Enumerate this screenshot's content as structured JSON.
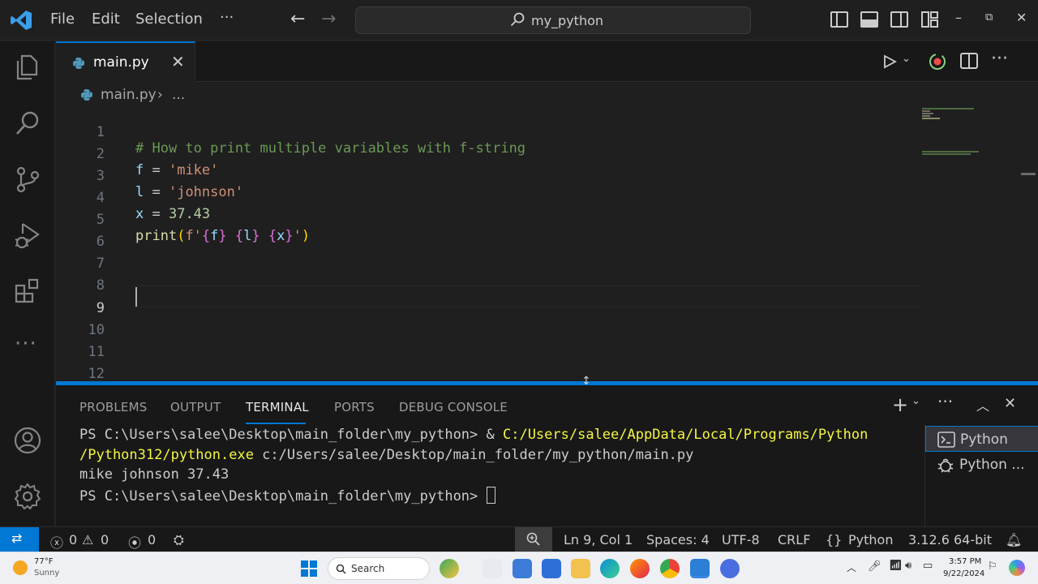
{
  "colors": {
    "accent": "#0078d4",
    "editor_bg": "#1f1f1f",
    "comment": "#6a9955",
    "string": "#ce9178",
    "variable": "#9cdcfe",
    "number": "#b5cea8",
    "function": "#dcdcaa",
    "terminal_path": "#f5f543"
  },
  "menu": {
    "file": "File",
    "edit": "Edit",
    "selection": "Selection",
    "more": "···"
  },
  "command_center": {
    "text": "my_python",
    "icon": "search-icon"
  },
  "activity_bar": {
    "top": [
      "explorer-icon",
      "search-icon",
      "source-control-icon",
      "run-debug-icon",
      "extensions-icon",
      "more-icon"
    ],
    "bottom": [
      "account-icon",
      "settings-gear-icon"
    ]
  },
  "tab": {
    "label": "main.py",
    "close": "✕"
  },
  "breadcrumb": {
    "file": "main.py",
    "separator": "›",
    "more": "..."
  },
  "editor": {
    "line_numbers": [
      "1",
      "2",
      "3",
      "4",
      "5",
      "6",
      "7",
      "8",
      "9",
      "10",
      "11",
      "12"
    ],
    "active_line": "9",
    "lines": {
      "l1": "# How to print multiple variables with f-string",
      "l2_var": "f",
      "l2_op": " = ",
      "l2_str": "'mike'",
      "l3_var": "l",
      "l3_op": " = ",
      "l3_str": "'johnson'",
      "l4_var": "x",
      "l4_op": " = ",
      "l4_num": "37.43",
      "l5_fn": "print",
      "l5_paren_open": "(",
      "l5_prefix": "f'",
      "l5_b1": "{",
      "l5_v1": "f",
      "l5_b2": "}",
      "l5_sp1": " ",
      "l5_b3": "{",
      "l5_v2": "l",
      "l5_b4": "}",
      "l5_sp2": " ",
      "l5_b5": "{",
      "l5_v3": "x",
      "l5_b6": "}",
      "l5_quote": "'",
      "l5_paren_close": ")"
    }
  },
  "panel": {
    "tabs": [
      "PROBLEMS",
      "OUTPUT",
      "TERMINAL",
      "PORTS",
      "DEBUG CONSOLE"
    ],
    "active_tab": "TERMINAL",
    "terminal": {
      "line1_prompt": "PS C:\\Users\\salee\\Desktop\\main_folder\\my_python> & ",
      "line1_path": "C:/Users/salee/AppData/Local/Programs/Python",
      "line2_path": "/Python312/python.exe",
      "line2_rest": " c:/Users/salee/Desktop/main_folder/my_python/main.py",
      "line3": "mike johnson 37.43",
      "line4_prompt": "PS C:\\Users\\salee\\Desktop\\main_folder\\my_python> "
    },
    "terminal_list": [
      {
        "label": "Python",
        "icon": "terminal-icon"
      },
      {
        "label": "Python ...",
        "icon": "debug-icon"
      }
    ]
  },
  "status_bar": {
    "errors": "0",
    "warnings": "0",
    "ports": "0",
    "position": "Ln 9, Col 1",
    "spaces": "Spaces: 4",
    "encoding": "UTF-8",
    "eol": "CRLF",
    "language_braces": "{}",
    "language": "Python",
    "interpreter": "3.12.6 64-bit"
  },
  "taskbar": {
    "weather_temp": "77°F",
    "weather_cond": "Sunny",
    "search": "Search",
    "time": "3:57 PM",
    "date": "9/22/2024"
  }
}
